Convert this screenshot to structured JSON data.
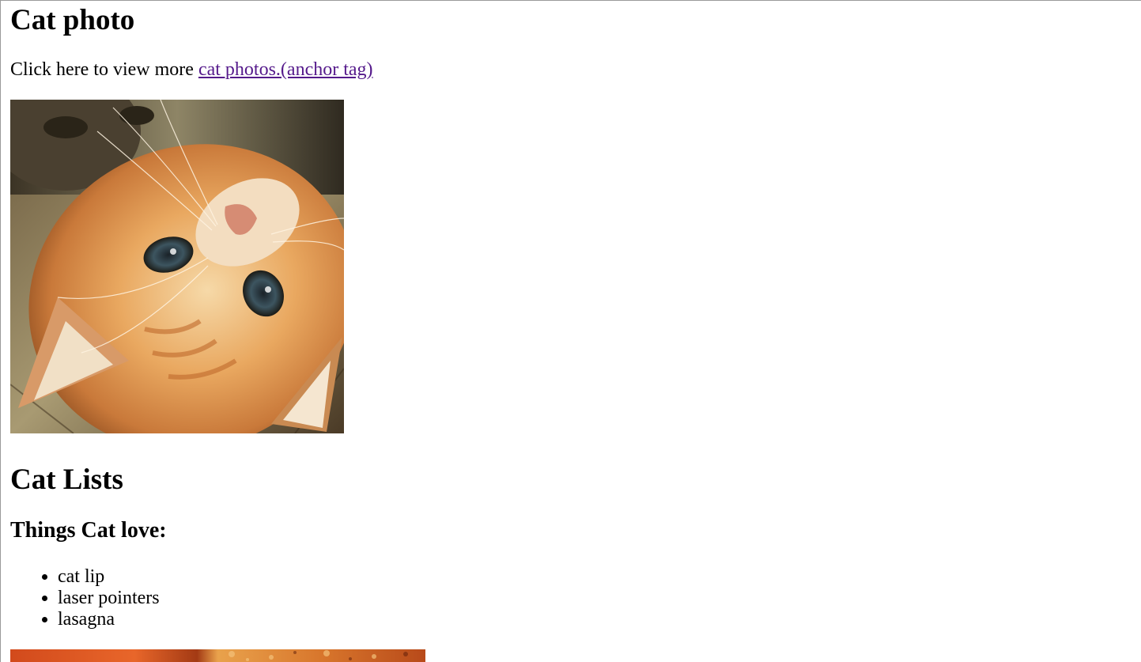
{
  "heading_photo": "Cat photo",
  "intro": {
    "text": "Click here to view more ",
    "link_text": "cat photos.(anchor tag)"
  },
  "heading_lists": "Cat Lists",
  "heading_love": "Things Cat love:",
  "love_list": [
    "cat lip",
    "laser pointers",
    "lasagna"
  ],
  "colors": {
    "link_visited": "#551a8b",
    "text": "#000000",
    "background": "#ffffff"
  }
}
